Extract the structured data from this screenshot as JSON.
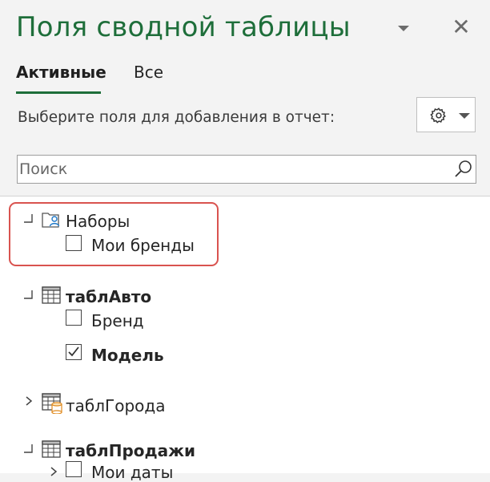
{
  "pane": {
    "title": "Поля сводной таблицы",
    "tabs": [
      {
        "label": "Активные",
        "active": true
      },
      {
        "label": "Все",
        "active": false
      }
    ],
    "instruction": "Выберите поля для добавления в отчет:",
    "search": {
      "placeholder": "Поиск",
      "value": ""
    }
  },
  "tree": {
    "sets_group": {
      "label": "Наборы",
      "expanded": true,
      "items": [
        {
          "label": "Мои бренды",
          "checked": false
        }
      ]
    },
    "tables": [
      {
        "label": "таблАвто",
        "bold": true,
        "expanded": true,
        "fields": [
          {
            "label": "Бренд",
            "checked": false,
            "bold": false
          },
          {
            "label": "Модель",
            "checked": true,
            "bold": true
          }
        ]
      },
      {
        "label": "таблГорода",
        "bold": false,
        "expanded": false,
        "fields": []
      },
      {
        "label": "таблПродажи",
        "bold": true,
        "expanded": true,
        "fields": [
          {
            "label": "Мои даты",
            "checked": false,
            "bold": false
          }
        ]
      }
    ]
  },
  "colors": {
    "accent": "#1e6e3a",
    "highlight_border": "#d9534f"
  }
}
